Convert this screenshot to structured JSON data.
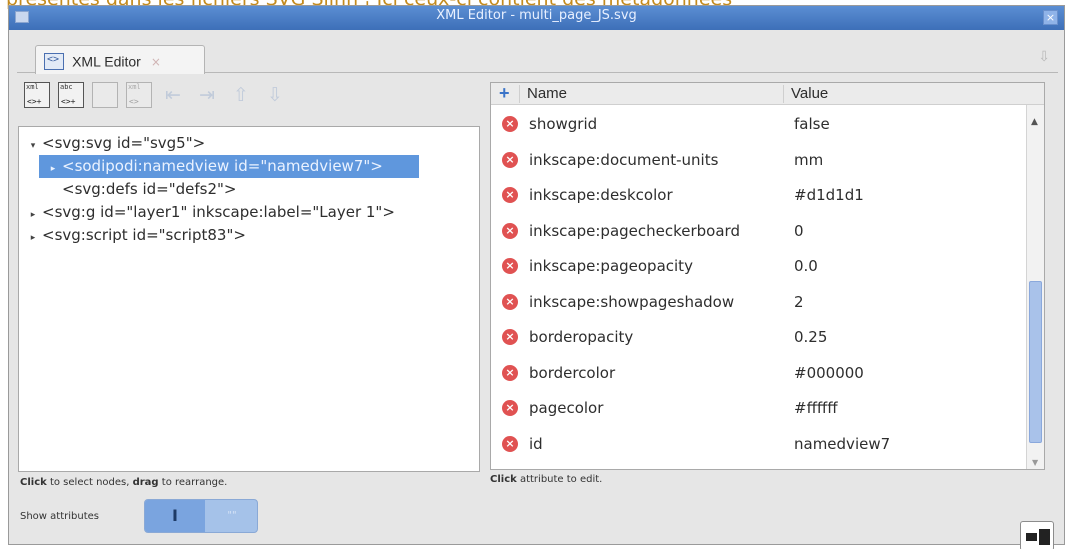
{
  "top_banner_text": "présentés dans les fichiers SVG Siinh ¦ Ici ceux-ci contient des métadonnées",
  "window": {
    "title": "XML Editor - multi_page_JS.svg",
    "close_glyph": "×"
  },
  "tab": {
    "label": "XML Editor",
    "close_glyph": "×"
  },
  "toolbar": {
    "buttons": [
      {
        "name": "new-element-node-button",
        "top": "xml",
        "bottom": "<>+",
        "enabled": true
      },
      {
        "name": "new-text-node-button",
        "top": "abc",
        "bottom": "<>+",
        "enabled": true
      },
      {
        "name": "duplicate-node-button",
        "top": "",
        "bottom": "",
        "enabled": false
      },
      {
        "name": "delete-node-button",
        "top": "xml",
        "bottom": "<>",
        "enabled": false
      },
      {
        "name": "unindent-node-button",
        "glyph": "⇤",
        "enabled": false
      },
      {
        "name": "indent-node-button",
        "glyph": "⇥",
        "enabled": false
      },
      {
        "name": "raise-node-button",
        "glyph": "⇧",
        "enabled": false
      },
      {
        "name": "lower-node-button",
        "glyph": "⇩",
        "enabled": false
      }
    ]
  },
  "tree": {
    "nodes": [
      {
        "text": "<svg:svg id=\"svg5\">",
        "arrow": "▾",
        "indent": 0,
        "selected": false
      },
      {
        "text": "<sodipodi:namedview id=\"namedview7\">",
        "arrow": "▸",
        "indent": 1,
        "selected": true
      },
      {
        "text": "<svg:defs id=\"defs2\">",
        "arrow": "",
        "indent": 1,
        "selected": false
      },
      {
        "text": "<svg:g id=\"layer1\" inkscape:label=\"Layer 1\">",
        "arrow": "▸",
        "indent": 0,
        "selected": false
      },
      {
        "text": "<svg:script id=\"script83\">",
        "arrow": "▸",
        "indent": 0,
        "selected": false
      }
    ]
  },
  "hints": {
    "left_bold1": "Click",
    "left_mid": " to select nodes, ",
    "left_bold2": "drag",
    "left_end": " to rearrange.",
    "right_bold": "Click",
    "right_end": " attribute to edit."
  },
  "show_attributes": {
    "label": "Show attributes",
    "on_glyph": "I",
    "off_glyph": "\"\""
  },
  "attributes": {
    "add_glyph": "+",
    "header_name": "Name",
    "header_value": "Value",
    "rows": [
      {
        "name": "showgrid",
        "value": "false"
      },
      {
        "name": "inkscape:document-units",
        "value": "mm"
      },
      {
        "name": "inkscape:deskcolor",
        "value": "#d1d1d1"
      },
      {
        "name": "inkscape:pagecheckerboard",
        "value": "0"
      },
      {
        "name": "inkscape:pageopacity",
        "value": "0.0"
      },
      {
        "name": "inkscape:showpageshadow",
        "value": "2"
      },
      {
        "name": "borderopacity",
        "value": "0.25"
      },
      {
        "name": "bordercolor",
        "value": "#000000"
      },
      {
        "name": "pagecolor",
        "value": "#ffffff"
      },
      {
        "name": "id",
        "value": "namedview7"
      }
    ],
    "delete_glyph": "×"
  },
  "colors": {
    "titlebar": "#4a7fc6",
    "selection": "#5f97dd",
    "delete_icon": "#e05252",
    "toggle": "#7aa4df"
  }
}
